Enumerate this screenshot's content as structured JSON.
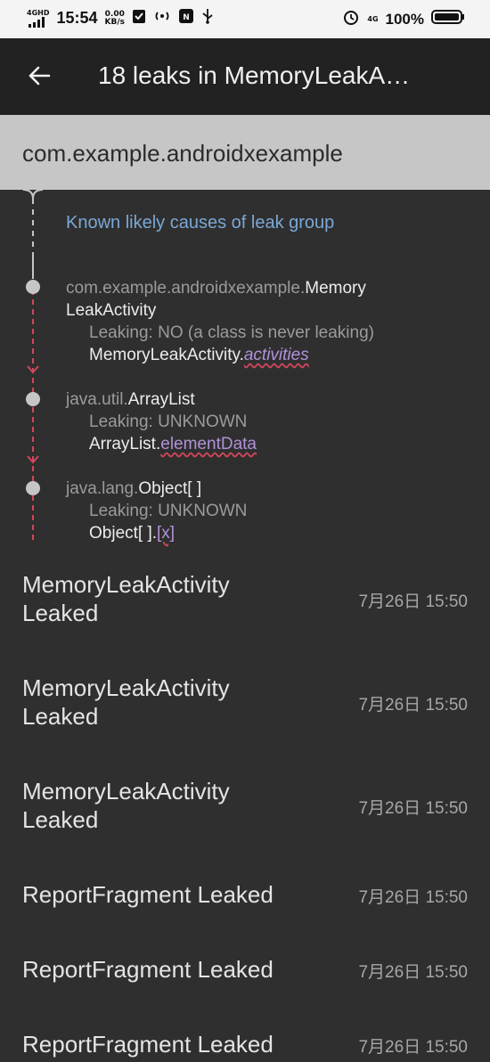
{
  "status_bar": {
    "network_type": "4GHD",
    "time": "15:54",
    "speed_value": "0.00",
    "speed_unit": "KB/s",
    "network_right": "4G",
    "battery": "100%",
    "icons": [
      "signal-icon",
      "check-icon",
      "hotspot-icon",
      "nfc-icon",
      "usb-icon",
      "alarm-icon",
      "battery-icon"
    ]
  },
  "toolbar": {
    "back_icon": "arrow-back-icon",
    "title": "18 leaks in MemoryLeakA…"
  },
  "group_header": {
    "package": "com.example.androidxexample"
  },
  "trace": {
    "causes_label": "Known likely causes of leak group",
    "nodes": [
      {
        "class_prefix": "com.example.androidxexample.",
        "class_prefix_line1": "com.example.androidxexample.",
        "class_name_part1": "Memory",
        "class_name_part2": "LeakActivity",
        "leaking": "Leaking: NO (a class is never leaking)",
        "ref_owner": "MemoryLeakActivity.",
        "ref_field": "activities"
      },
      {
        "class_prefix": "java.util.",
        "class_name": "ArrayList",
        "leaking": "Leaking: UNKNOWN",
        "ref_owner": "ArrayList.",
        "ref_field": "elementData"
      },
      {
        "class_prefix": "java.lang.",
        "class_name": "Object[ ]",
        "leaking": "Leaking: UNKNOWN",
        "ref_owner": "Object[ ].",
        "ref_field": "[x]"
      }
    ]
  },
  "leaks": [
    {
      "title_line1": "MemoryLeakActivity",
      "title_line2": "Leaked",
      "time": "7月26日 15:50"
    },
    {
      "title_line1": "MemoryLeakActivity",
      "title_line2": "Leaked",
      "time": "7月26日 15:50"
    },
    {
      "title_line1": "MemoryLeakActivity",
      "title_line2": "Leaked",
      "time": "7月26日 15:50"
    },
    {
      "title_line1": "ReportFragment Leaked",
      "title_line2": "",
      "time": "7月26日 15:50"
    },
    {
      "title_line1": "ReportFragment Leaked",
      "title_line2": "",
      "time": "7月26日 15:50"
    },
    {
      "title_line1": "ReportFragment Leaked",
      "title_line2": "",
      "time": "7月26日 15:50"
    }
  ],
  "colors": {
    "accent_blue": "#7ba8d6",
    "reference_purple": "#b191d9",
    "leak_path_red": "#d2465c",
    "header_gray": "#c6c6c6",
    "background": "#2f2f2f",
    "toolbar": "#222222"
  }
}
